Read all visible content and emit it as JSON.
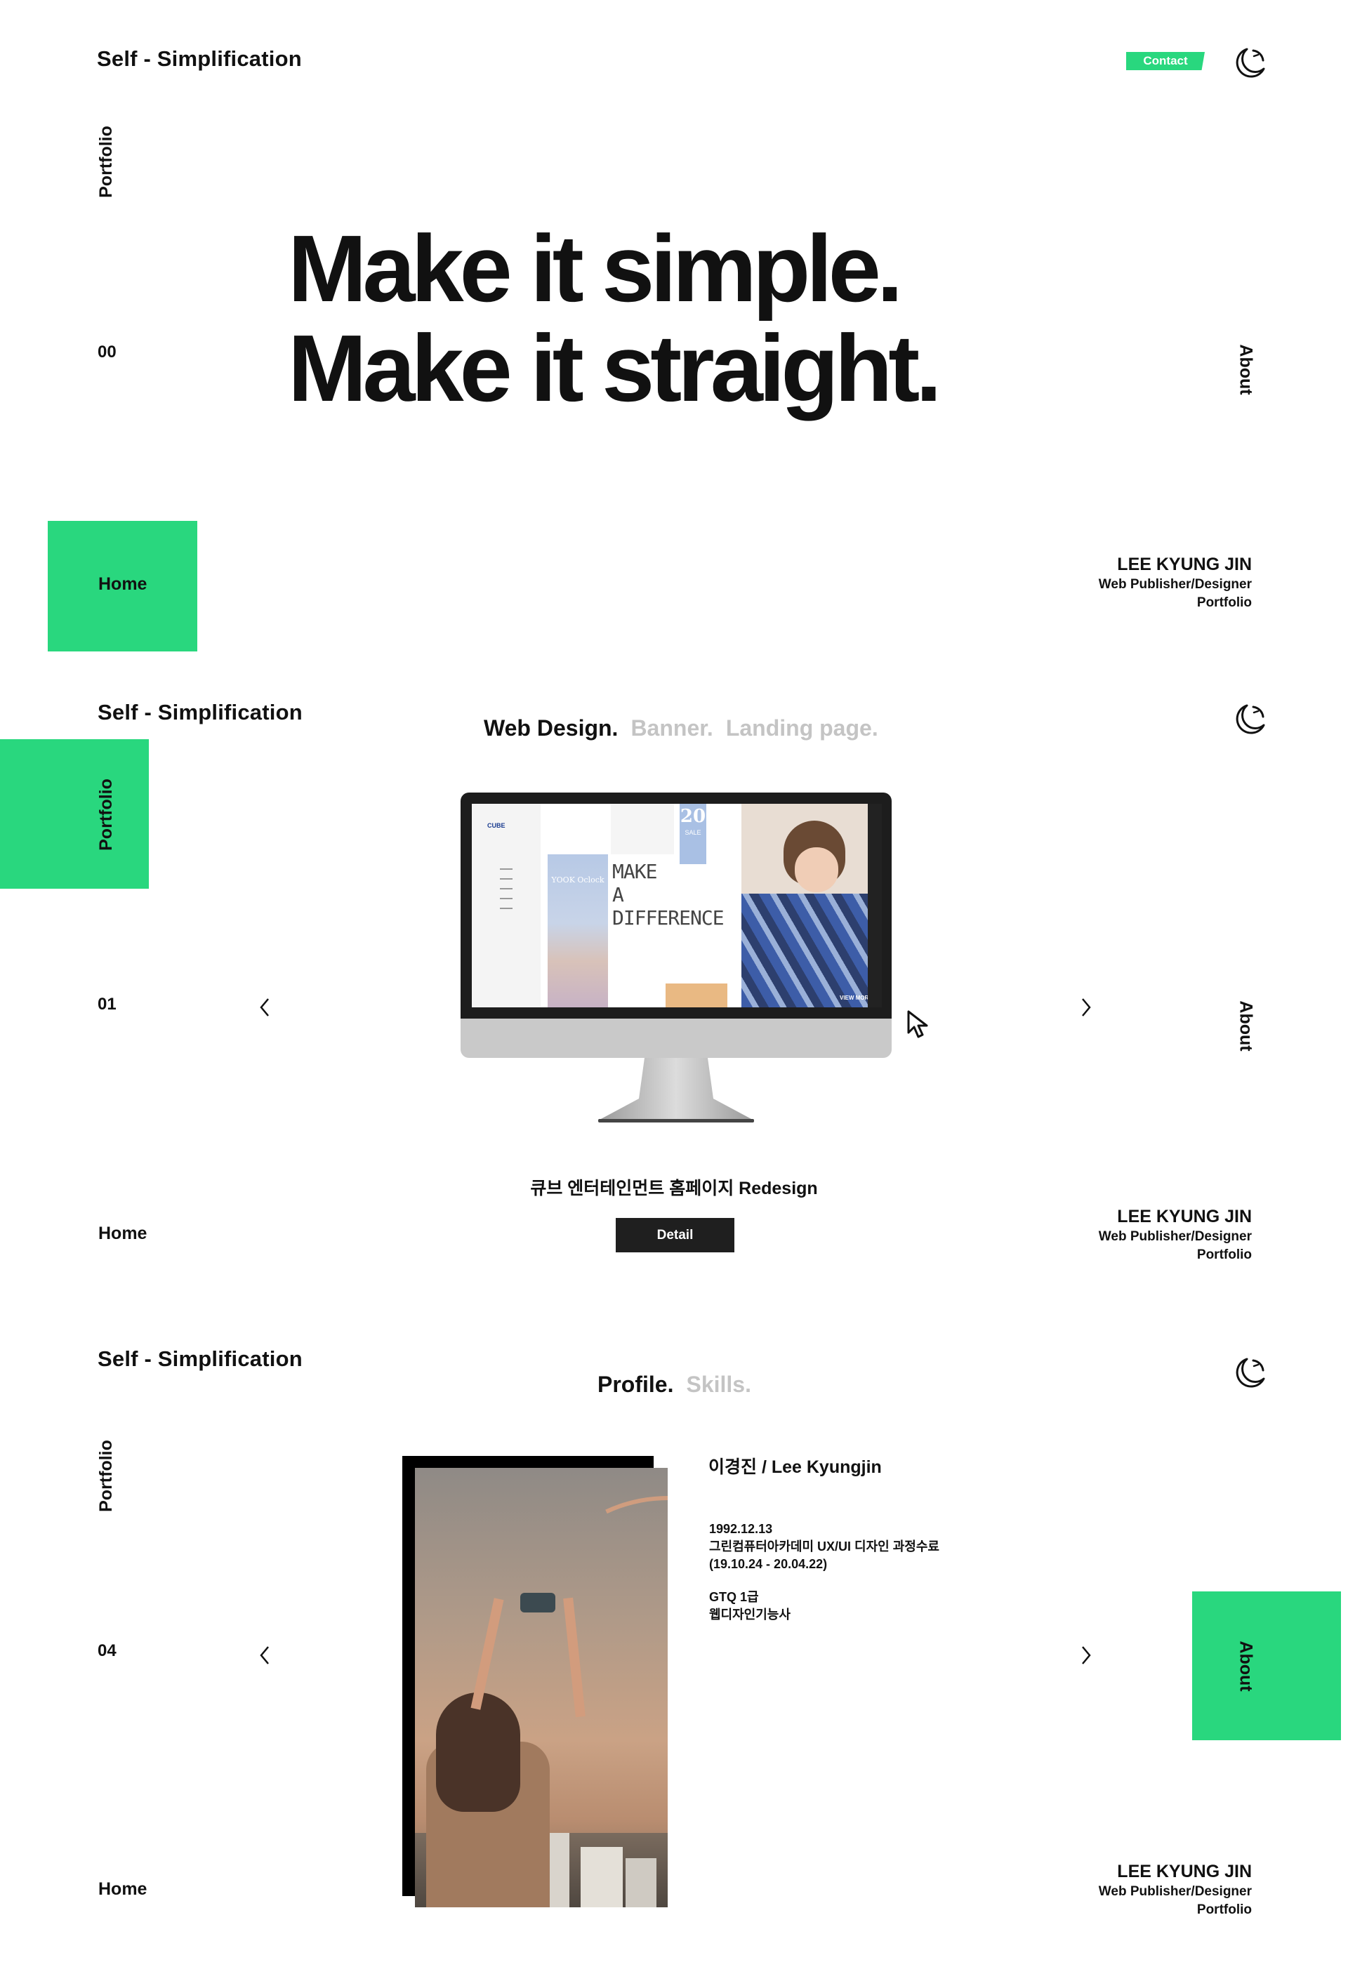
{
  "brand": "Self - Simplification",
  "nav": {
    "portfolio": "Portfolio",
    "about": "About",
    "home": "Home"
  },
  "identity": {
    "name": "LEE KYUNG JIN",
    "role": "Web Publisher/Designer",
    "portfolio": "Portfolio"
  },
  "colors": {
    "accent": "#29d77e",
    "dark": "#1f1f1f",
    "dim": "#c4c4c4"
  },
  "icons": {
    "theme_toggle": "moon-icon",
    "prev": "chevron-left-icon",
    "next": "chevron-right-icon",
    "cursor": "cursor-arrow-icon"
  },
  "section_home": {
    "page_number": "00",
    "contact_label": "Contact",
    "hero_line1": "Make it simple.",
    "hero_line2": "Make it straight."
  },
  "section_portfolio": {
    "page_number": "01",
    "tabs": [
      "Web Design.",
      "Banner.",
      "Landing page."
    ],
    "monitor": {
      "site_logo": "CUBE",
      "poster_text": "YOOK Oclock",
      "headline": [
        "MAKE",
        "A",
        "DIFFERENCE"
      ],
      "badge_number": "20",
      "badge_sub": "SALE",
      "view_more": "VIEW MORE"
    },
    "project_title": "큐브 엔터테인먼트 홈페이지 Redesign",
    "detail_label": "Detail"
  },
  "section_about": {
    "page_number": "04",
    "tabs": [
      "Profile.",
      "Skills."
    ],
    "profile_name": "이경진 / Lee Kyungjin",
    "birth": "1992.12.13",
    "education": "그린컴퓨터아카데미 UX/UI 디자인 과정수료",
    "period": "(19.10.24 - 20.04.22)",
    "cert1": "GTQ 1급",
    "cert2": "웹디자인기능사"
  }
}
